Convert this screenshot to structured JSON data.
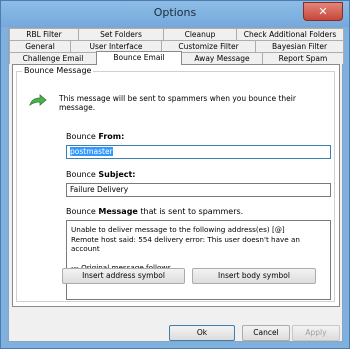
{
  "window": {
    "title": "Options",
    "close_glyph": "✕"
  },
  "tabs": {
    "row1": [
      "RBL Filter",
      "Set Folders",
      "Cleanup",
      "Check Additional Folders"
    ],
    "row2": [
      "General",
      "User Interface",
      "Customize Filter",
      "Bayesian Filter"
    ],
    "row3": [
      "Challenge Email",
      "Bounce Email",
      "Away Message",
      "Report Spam"
    ],
    "active": "Bounce Email"
  },
  "group": {
    "label": "Bounce Message",
    "icon": "green-arrow-icon"
  },
  "description": "This message will be sent to spammers when you bounce their message.",
  "from": {
    "label_prefix": "Bounce ",
    "label_bold": "From:",
    "value": "postmaster"
  },
  "subject": {
    "label_prefix": "Bounce ",
    "label_bold": "Subject:",
    "value": "Failure Delivery"
  },
  "message": {
    "label_prefix": "Bounce ",
    "label_bold": "Message",
    "label_suffix": " that is sent to spammers.",
    "lines": [
      "Unable to deliver message to the following address(es) [@]",
      "Remote host said: 554 delivery error: This user doesn't have an",
      "account",
      "",
      "--- Original message follows.",
      "[#]"
    ]
  },
  "buttons": {
    "insert_address": "Insert address symbol",
    "insert_body": "Insert body symbol",
    "ok": "Ok",
    "cancel": "Cancel",
    "apply": "Apply"
  },
  "colors": {
    "titlebar": "#7fb0de",
    "selection": "#3399ff",
    "arrow": "#4caf50"
  }
}
